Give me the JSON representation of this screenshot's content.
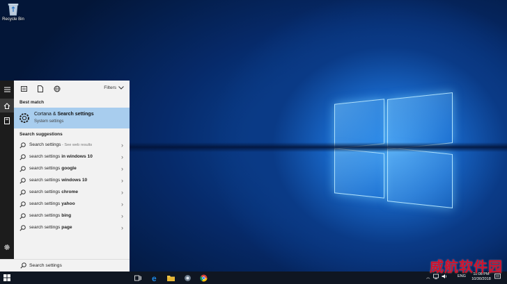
{
  "desktop": {
    "recycle_bin_label": "Recycle Bin"
  },
  "search_panel": {
    "filters_label": "Filters",
    "best_match_heading": "Best match",
    "best_match": {
      "title_plain": "Cortana & ",
      "title_bold": "Search settings",
      "subtitle": "System settings"
    },
    "suggestions_heading": "Search suggestions",
    "suggestions": [
      {
        "prefix": "Search settings",
        "bold": "",
        "extra": " - See web results"
      },
      {
        "prefix": "search settings ",
        "bold": "in windows 10",
        "extra": ""
      },
      {
        "prefix": "search settings ",
        "bold": "google",
        "extra": ""
      },
      {
        "prefix": "search settings ",
        "bold": "windows 10",
        "extra": ""
      },
      {
        "prefix": "search settings ",
        "bold": "chrome",
        "extra": ""
      },
      {
        "prefix": "search settings ",
        "bold": "yahoo",
        "extra": ""
      },
      {
        "prefix": "search settings ",
        "bold": "bing",
        "extra": ""
      },
      {
        "prefix": "search settings ",
        "bold": "page",
        "extra": ""
      }
    ],
    "search_value": "Search settings"
  },
  "taskbar": {
    "language": "ENG",
    "time": "11:08 PM",
    "date": "10/30/2018"
  },
  "watermark": "威航软件园",
  "colors": {
    "selection": "#a8cdee",
    "taskbar": "#0f1622",
    "edge_blue": "#1e88e5",
    "watermark_red": "#d0112b"
  }
}
